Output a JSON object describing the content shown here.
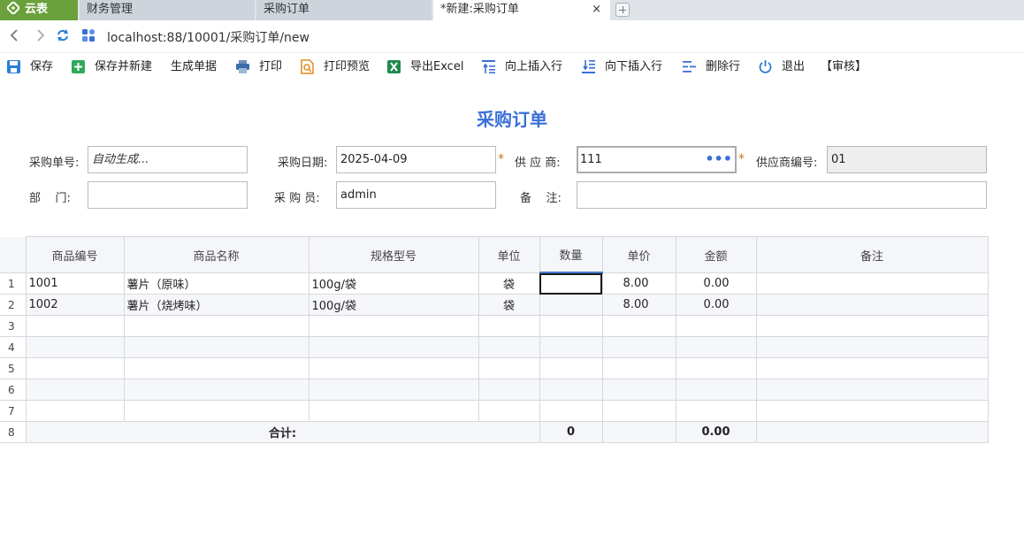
{
  "tabs": {
    "logo": "云表",
    "items": [
      "财务管理",
      "采购订单",
      "*新建:采购订单"
    ],
    "close": "×"
  },
  "address": {
    "url": "localhost:88/10001/采购订单/new"
  },
  "toolbar": {
    "save": "保存",
    "save_new": "保存并新建",
    "generate": "生成单据",
    "print": "打印",
    "print_preview": "打印预览",
    "export_excel": "导出Excel",
    "insert_up": "向上插入行",
    "insert_down": "向下插入行",
    "delete_row": "删除行",
    "exit": "退出",
    "audit": "【审核】"
  },
  "form": {
    "title": "采购订单",
    "order_no_label": "采购单号:",
    "order_no_value": "自动生成...",
    "date_label": "采购日期:",
    "date_value": "2025-04-09",
    "supplier_label": "供 应 商:",
    "supplier_value": "111",
    "supplier_code_label": "供应商编号:",
    "supplier_code_value": "01",
    "dept_label": "部    门:",
    "dept_value": "",
    "buyer_label": "采 购 员:",
    "buyer_value": "admin",
    "remark_label": "备    注:",
    "remark_value": "",
    "required_mark": "*",
    "more": "•••"
  },
  "grid": {
    "headers": [
      "商品编号",
      "商品名称",
      "规格型号",
      "单位",
      "数量",
      "单价",
      "金额",
      "备注"
    ],
    "rows": [
      {
        "no": "1",
        "code": "1001",
        "name": "薯片（原味）",
        "spec": "100g/袋",
        "unit": "袋",
        "qty": "",
        "price": "8.00",
        "amount": "0.00",
        "remark": ""
      },
      {
        "no": "2",
        "code": "1002",
        "name": "薯片（烧烤味）",
        "spec": "100g/袋",
        "unit": "袋",
        "qty": "",
        "price": "8.00",
        "amount": "0.00",
        "remark": ""
      },
      {
        "no": "3",
        "code": "",
        "name": "",
        "spec": "",
        "unit": "",
        "qty": "",
        "price": "",
        "amount": "",
        "remark": ""
      },
      {
        "no": "4",
        "code": "",
        "name": "",
        "spec": "",
        "unit": "",
        "qty": "",
        "price": "",
        "amount": "",
        "remark": ""
      },
      {
        "no": "5",
        "code": "",
        "name": "",
        "spec": "",
        "unit": "",
        "qty": "",
        "price": "",
        "amount": "",
        "remark": ""
      },
      {
        "no": "6",
        "code": "",
        "name": "",
        "spec": "",
        "unit": "",
        "qty": "",
        "price": "",
        "amount": "",
        "remark": ""
      },
      {
        "no": "7",
        "code": "",
        "name": "",
        "spec": "",
        "unit": "",
        "qty": "",
        "price": "",
        "amount": "",
        "remark": ""
      }
    ],
    "total": {
      "no": "8",
      "label": "合计:",
      "qty": "0",
      "amount": "0.00"
    }
  },
  "colors": {
    "accent": "#3a6fd8",
    "logo_green": "#6aa13a",
    "required": "#c0781e"
  }
}
